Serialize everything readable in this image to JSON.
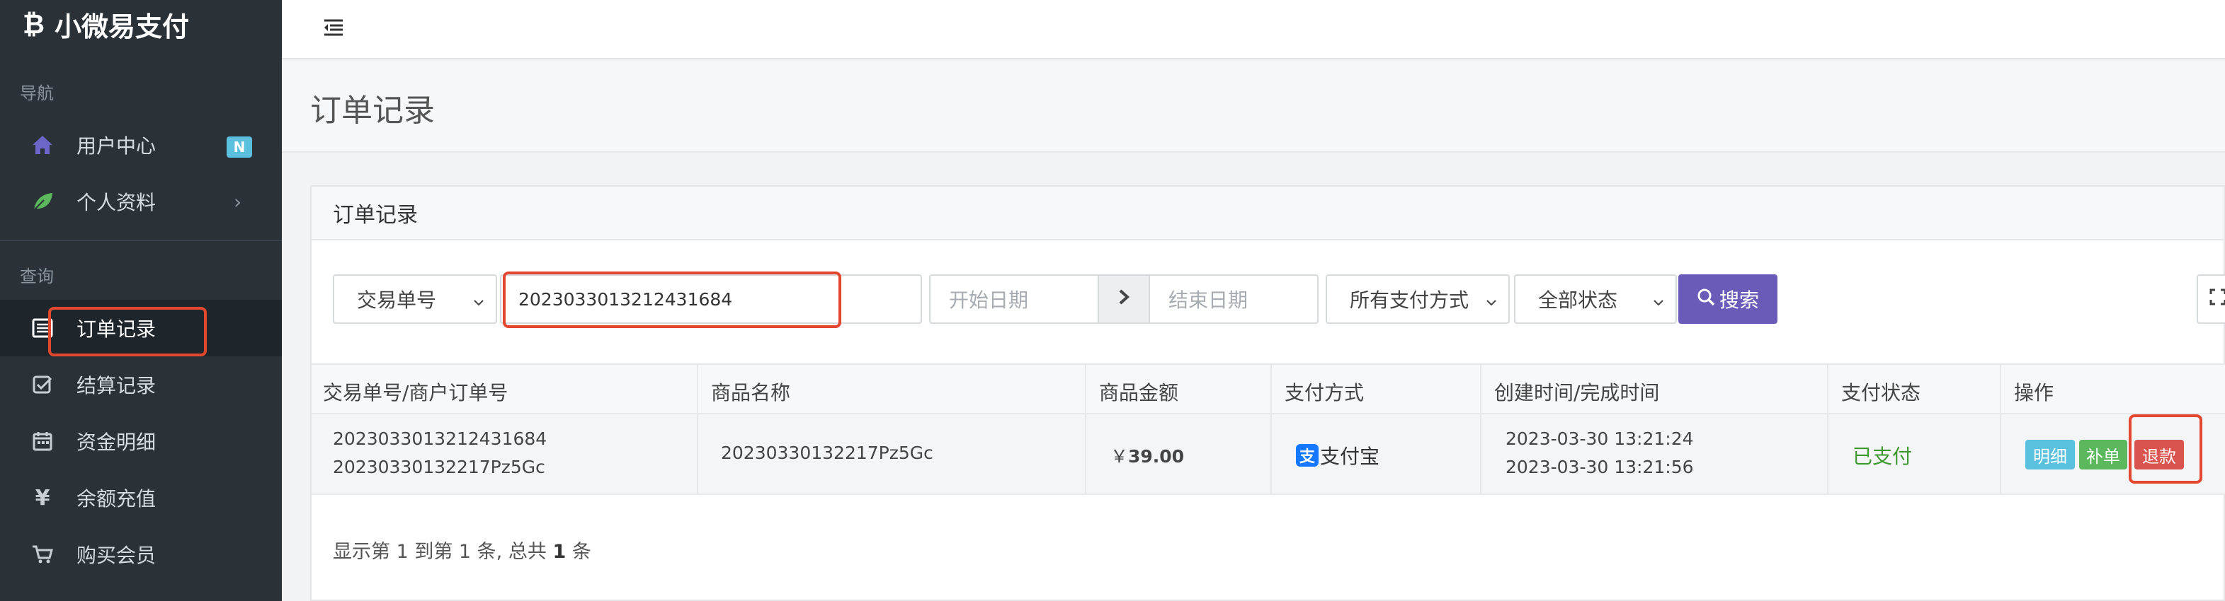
{
  "brand": {
    "name": "小微易支付"
  },
  "sidebar": {
    "section_nav": "导航",
    "section_query": "查询",
    "items": [
      {
        "label": "用户中心",
        "icon": "home-icon",
        "badge": "N"
      },
      {
        "label": "个人资料",
        "icon": "leaf-icon"
      },
      {
        "label": "订单记录",
        "icon": "list-icon",
        "active": true
      },
      {
        "label": "结算记录",
        "icon": "check-square-icon"
      },
      {
        "label": "资金明细",
        "icon": "calendar-icon"
      },
      {
        "label": "余额充值",
        "icon": "yen-icon"
      },
      {
        "label": "购买会员",
        "icon": "cart-icon"
      }
    ]
  },
  "page": {
    "title": "订单记录"
  },
  "panel": {
    "title": "订单记录"
  },
  "filters": {
    "search_type": "交易单号",
    "search_value": "2023033013212431684",
    "start_date_placeholder": "开始日期",
    "end_date_placeholder": "结束日期",
    "pay_method": "所有支付方式",
    "status": "全部状态",
    "search_label": "搜索"
  },
  "table": {
    "headers": [
      "交易单号/商户订单号",
      "商品名称",
      "商品金额",
      "支付方式",
      "创建时间/完成时间",
      "支付状态",
      "操作"
    ],
    "rows": [
      {
        "trade_no": "2023033013212431684",
        "out_trade_no": "20230330132217Pz5Gc",
        "product": "20230330132217Pz5Gc",
        "currency": "￥",
        "amount": "39.00",
        "pay_method": "支付宝",
        "created": "2023-03-30 13:21:24",
        "completed": "2023-03-30 13:21:56",
        "status": "已支付",
        "actions": {
          "detail": "明细",
          "reissue": "补单",
          "refund": "退款"
        }
      }
    ]
  },
  "summary": {
    "prefix": "显示第 1 到第 1 条, 总共 ",
    "total": "1",
    "suffix": " 条"
  },
  "colors": {
    "sidebar_bg": "#2a3238",
    "accent": "#6a5bb8",
    "highlight": "#e5462f",
    "paid": "#3d9a2f",
    "detail_btn": "#5bc0de",
    "reissue_btn": "#5cb85c",
    "refund_btn": "#d9534f"
  }
}
